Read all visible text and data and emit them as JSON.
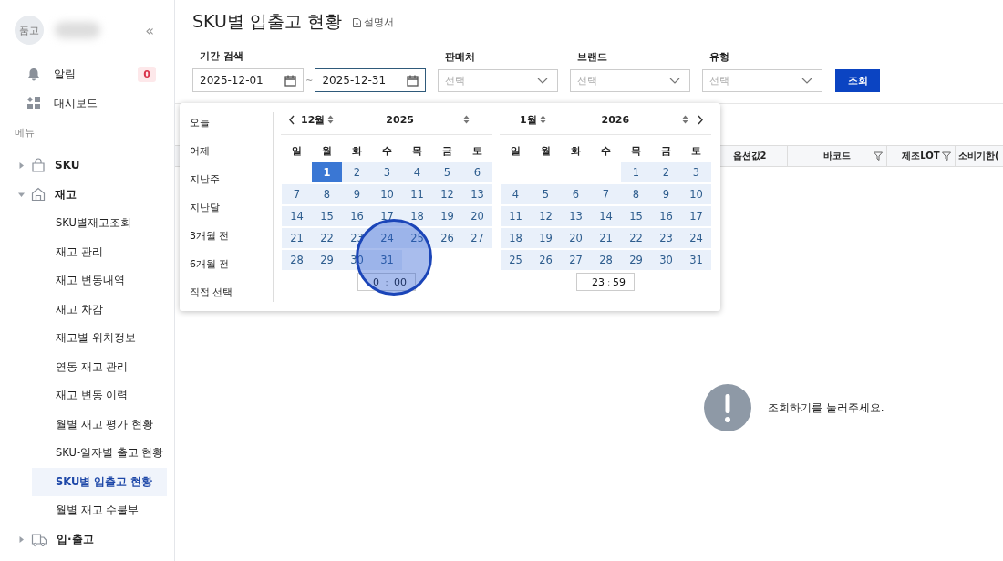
{
  "sidebar": {
    "avatar": "품고",
    "collapse": "«",
    "items": [
      {
        "kind": "bell",
        "label": "알림",
        "badge": "0"
      },
      {
        "kind": "grid",
        "label": "대시보드"
      }
    ],
    "section": "메뉴",
    "tree": [
      {
        "kind": "bag",
        "label": "SKU",
        "expanded": false
      },
      {
        "kind": "house",
        "label": "재고",
        "expanded": true,
        "children": [
          {
            "label": "SKU별재고조회",
            "selected": false
          },
          {
            "label": "재고 관리",
            "selected": false
          },
          {
            "label": "재고 변동내역",
            "selected": false
          },
          {
            "label": "재고 차감",
            "selected": false
          },
          {
            "label": "재고별 위치정보",
            "selected": false
          },
          {
            "label": "연동 재고 관리",
            "selected": false
          },
          {
            "label": "재고 변동 이력",
            "selected": false
          },
          {
            "label": "월별 재고 평가 현황",
            "selected": false
          },
          {
            "label": "SKU-일자별 출고 현황",
            "selected": false
          },
          {
            "label": "SKU별 입출고 현황",
            "selected": true
          },
          {
            "label": "월별 재고 수불부",
            "selected": false
          }
        ]
      },
      {
        "kind": "truck",
        "label": "입·출고",
        "expanded": false
      }
    ]
  },
  "page": {
    "title": "SKU별 입출고 현황",
    "manual_link": "설명서"
  },
  "filters": {
    "period": {
      "label": "기간 검색",
      "start": "2025-12-01",
      "separator": "~",
      "end": "2025-12-31",
      "end_focused": true
    },
    "selects": [
      {
        "label": "판매처",
        "placeholder": "선택"
      },
      {
        "label": "브랜드",
        "placeholder": "선택"
      },
      {
        "label": "유형",
        "placeholder": "선택"
      }
    ],
    "search_button": "조회"
  },
  "date_picker": {
    "presets": [
      "오늘",
      "어제",
      "지난주",
      "지난달",
      "3개월 전",
      "6개월 전",
      "직접 선택"
    ],
    "months": [
      {
        "month": "12월",
        "year": "2025",
        "weekdays": [
          "일",
          "월",
          "화",
          "수",
          "목",
          "금",
          "토"
        ],
        "weeks": [
          {
            "days": [
              {
                "t": "1",
                "selected": true
              },
              {
                "t": "2",
                "selected": false
              },
              {
                "t": "3",
                "selected": false
              },
              {
                "t": "4",
                "selected": false
              },
              {
                "t": "5",
                "selected": false
              },
              {
                "t": "6",
                "selected": false
              }
            ]
          },
          {
            "days": [
              {
                "t": "7",
                "selected": false
              },
              {
                "t": "8",
                "selected": false
              },
              {
                "t": "9",
                "selected": false
              },
              {
                "t": "10",
                "selected": false
              },
              {
                "t": "11",
                "selected": false
              },
              {
                "t": "12",
                "selected": false
              },
              {
                "t": "13",
                "selected": false
              }
            ]
          },
          {
            "days": [
              {
                "t": "14",
                "selected": false
              },
              {
                "t": "15",
                "selected": false
              },
              {
                "t": "16",
                "selected": false
              },
              {
                "t": "17",
                "selected": false
              },
              {
                "t": "18",
                "selected": false
              },
              {
                "t": "19",
                "selected": false
              },
              {
                "t": "20",
                "selected": false
              }
            ]
          },
          {
            "days": [
              {
                "t": "21",
                "selected": false
              },
              {
                "t": "22",
                "selected": false
              },
              {
                "t": "23",
                "selected": false
              },
              {
                "t": "24",
                "selected": false
              },
              {
                "t": "25",
                "selected": false
              },
              {
                "t": "26",
                "selected": false
              },
              {
                "t": "27",
                "selected": false
              }
            ]
          },
          {
            "days": [
              {
                "t": "28",
                "selected": false
              },
              {
                "t": "29",
                "selected": false
              },
              {
                "t": "30",
                "selected": false
              },
              {
                "t": "31",
                "selected": false
              }
            ]
          }
        ],
        "time": {
          "hour": "0",
          "separator": ":",
          "minute": "00"
        }
      },
      {
        "month": "1월",
        "year": "2026",
        "weekdays": [
          "일",
          "월",
          "화",
          "수",
          "목",
          "금",
          "토"
        ],
        "weeks": [
          {
            "days": [
              {
                "t": "1",
                "selected": false
              },
              {
                "t": "2",
                "selected": false
              },
              {
                "t": "3",
                "selected": false
              }
            ]
          },
          {
            "days": [
              {
                "t": "4",
                "selected": false
              },
              {
                "t": "5",
                "selected": false
              },
              {
                "t": "6",
                "selected": false
              },
              {
                "t": "7",
                "selected": false
              },
              {
                "t": "8",
                "selected": false
              },
              {
                "t": "9",
                "selected": false
              },
              {
                "t": "10",
                "selected": false
              }
            ]
          },
          {
            "days": [
              {
                "t": "11",
                "selected": false
              },
              {
                "t": "12",
                "selected": false
              },
              {
                "t": "13",
                "selected": false
              },
              {
                "t": "14",
                "selected": false
              },
              {
                "t": "15",
                "selected": false
              },
              {
                "t": "16",
                "selected": false
              },
              {
                "t": "17",
                "selected": false
              }
            ]
          },
          {
            "days": [
              {
                "t": "18",
                "selected": false
              },
              {
                "t": "19",
                "selected": false
              },
              {
                "t": "20",
                "selected": false
              },
              {
                "t": "21",
                "selected": false
              },
              {
                "t": "22",
                "selected": false
              },
              {
                "t": "23",
                "selected": false
              },
              {
                "t": "24",
                "selected": false
              }
            ]
          },
          {
            "days": [
              {
                "t": "25",
                "selected": false
              },
              {
                "t": "26",
                "selected": false
              },
              {
                "t": "27",
                "selected": false
              },
              {
                "t": "28",
                "selected": false
              },
              {
                "t": "29",
                "selected": false
              },
              {
                "t": "30",
                "selected": false
              },
              {
                "t": "31",
                "selected": false
              }
            ]
          }
        ],
        "time": {
          "hour": "23",
          "separator": ":",
          "minute": "59"
        }
      }
    ]
  },
  "table": {
    "columns": [
      {
        "label": "옵션값2",
        "filter": false
      },
      {
        "label": "바코드",
        "filter": true
      },
      {
        "label": "제조LOT",
        "filter": true
      },
      {
        "label": "소비기한(",
        "filter": false
      }
    ]
  },
  "empty_state": {
    "message": "조회하기를 눌러주세요."
  },
  "touch_indicator": {
    "visible": true
  }
}
